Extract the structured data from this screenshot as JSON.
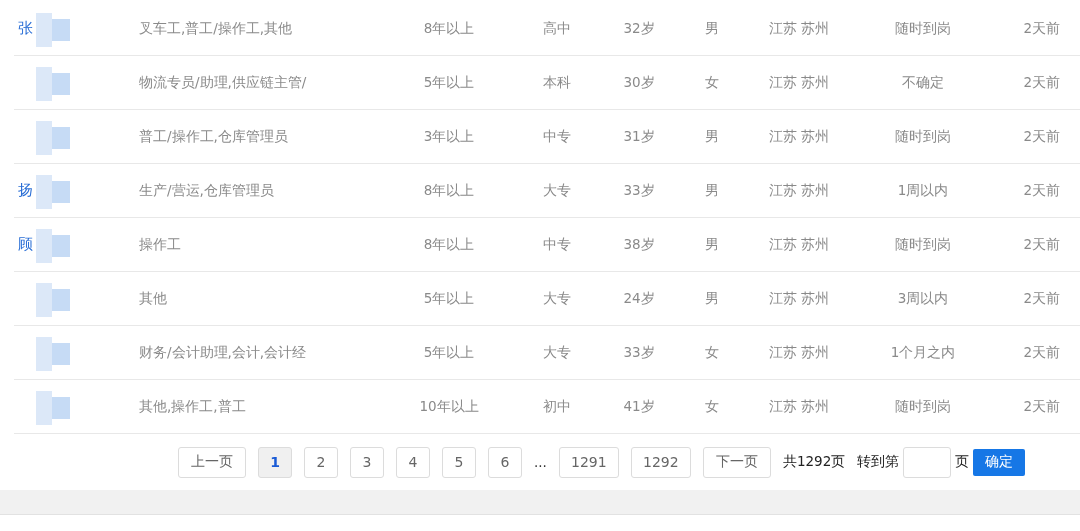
{
  "rows": [
    {
      "name": "张",
      "jobs": "叉车工,普工/操作工,其他",
      "experience": "8年以上",
      "education": "高中",
      "age": "32岁",
      "gender": "男",
      "location": "江苏 苏州",
      "availability": "随时到岗",
      "updated": "2天前"
    },
    {
      "jobs": "物流专员/助理,供应链主管/",
      "experience": "5年以上",
      "education": "本科",
      "age": "30岁",
      "gender": "女",
      "location": "江苏 苏州",
      "availability": "不确定",
      "updated": "2天前"
    },
    {
      "jobs": "普工/操作工,仓库管理员",
      "experience": "3年以上",
      "education": "中专",
      "age": "31岁",
      "gender": "男",
      "location": "江苏 苏州",
      "availability": "随时到岗",
      "updated": "2天前"
    },
    {
      "name": "扬",
      "jobs": "生产/营运,仓库管理员",
      "experience": "8年以上",
      "education": "大专",
      "age": "33岁",
      "gender": "男",
      "location": "江苏 苏州",
      "availability": "1周以内",
      "updated": "2天前"
    },
    {
      "name": "顾",
      "jobs": "操作工",
      "experience": "8年以上",
      "education": "中专",
      "age": "38岁",
      "gender": "男",
      "location": "江苏 苏州",
      "availability": "随时到岗",
      "updated": "2天前"
    },
    {
      "jobs": "其他",
      "experience": "5年以上",
      "education": "大专",
      "age": "24岁",
      "gender": "男",
      "location": "江苏 苏州",
      "availability": "3周以内",
      "updated": "2天前"
    },
    {
      "jobs": "财务/会计助理,会计,会计经",
      "experience": "5年以上",
      "education": "大专",
      "age": "33岁",
      "gender": "女",
      "location": "江苏 苏州",
      "availability": "1个月之内",
      "updated": "2天前"
    },
    {
      "jobs": "其他,操作工,普工",
      "experience": "10年以上",
      "education": "初中",
      "age": "41岁",
      "gender": "女",
      "location": "江苏 苏州",
      "availability": "随时到岗",
      "updated": "2天前"
    }
  ],
  "pagination": {
    "prev": "上一页",
    "pages": [
      {
        "label": "1",
        "selected": true
      },
      {
        "label": "2",
        "selected": false
      },
      {
        "label": "3",
        "selected": false
      },
      {
        "label": "4",
        "selected": false
      },
      {
        "label": "5",
        "selected": false
      },
      {
        "label": "6",
        "selected": false
      },
      {
        "label": "...",
        "kind": "ellipsis"
      },
      {
        "label": "1291",
        "selected": false
      },
      {
        "label": "1292",
        "selected": false
      }
    ],
    "next": "下一页",
    "total": "共1292页",
    "goto_label": "转到第",
    "goto_suffix": "页",
    "confirm": "确定"
  }
}
